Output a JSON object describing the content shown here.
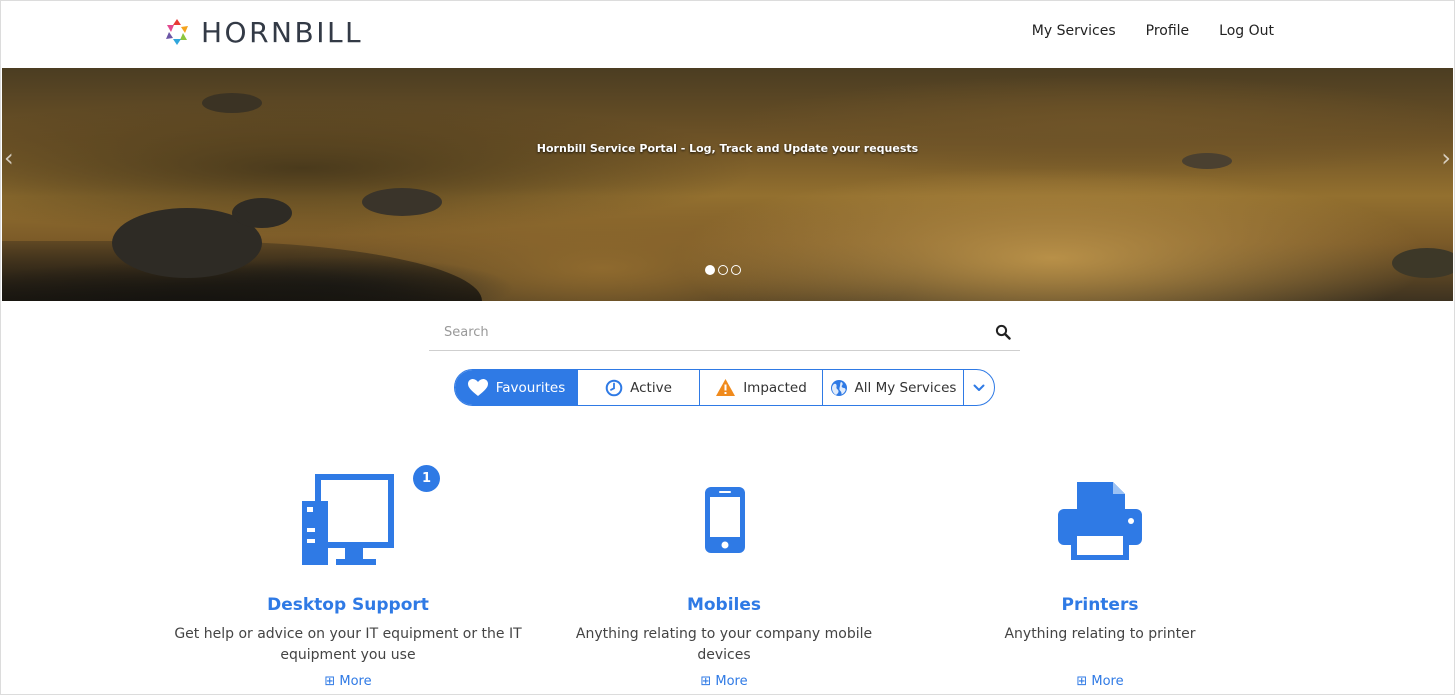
{
  "brand": {
    "name": "HORNBILL"
  },
  "nav": {
    "my_services": "My Services",
    "profile": "Profile",
    "logout": "Log Out"
  },
  "hero": {
    "caption": "Hornbill Service Portal - Log, Track and Update your requests",
    "slides": 3,
    "active_slide": 1
  },
  "search": {
    "placeholder": "Search",
    "value": ""
  },
  "filters": {
    "favourites": "Favourites",
    "active": "Active",
    "impacted": "Impacted",
    "all": "All My Services",
    "selected": "Favourites"
  },
  "services": [
    {
      "title": "Desktop Support",
      "description": "Get help or advice on your IT equipment or the IT equipment you use",
      "more": "More",
      "badge": "1",
      "icon": "desktop-computer-icon"
    },
    {
      "title": "Mobiles",
      "description": "Anything relating to your company mobile devices",
      "more": "More",
      "icon": "mobile-phone-icon"
    },
    {
      "title": "Printers",
      "description": "Anything relating to printer",
      "more": "More",
      "icon": "printer-icon"
    }
  ],
  "colors": {
    "accent": "#2f7ae5",
    "warning": "#f08a1c",
    "text": "#333333"
  }
}
